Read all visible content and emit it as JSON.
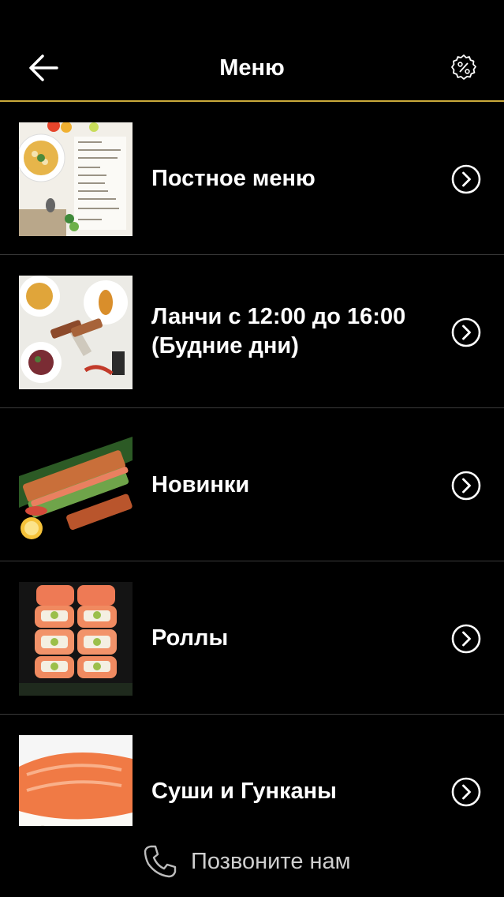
{
  "header": {
    "title": "Меню",
    "back_icon": "arrow-left-icon",
    "promo_icon": "discount-percent-icon",
    "accent_color": "#c9a93a"
  },
  "menu": {
    "items": [
      {
        "label": "Постное меню",
        "image": "lenten-menu-photo"
      },
      {
        "label": "Ланчи с 12:00 до 16:00 (Будние дни)",
        "image": "lunch-dishes-photo"
      },
      {
        "label": "Новинки",
        "image": "new-sushi-platter-photo"
      },
      {
        "label": "Роллы",
        "image": "salmon-rolls-photo"
      },
      {
        "label": "Суши и Гунканы",
        "image": "salmon-nigiri-photo"
      }
    ],
    "chevron_icon": "chevron-right-circle-icon"
  },
  "footer": {
    "call_label": "Позвоните нам",
    "call_icon": "phone-icon"
  }
}
